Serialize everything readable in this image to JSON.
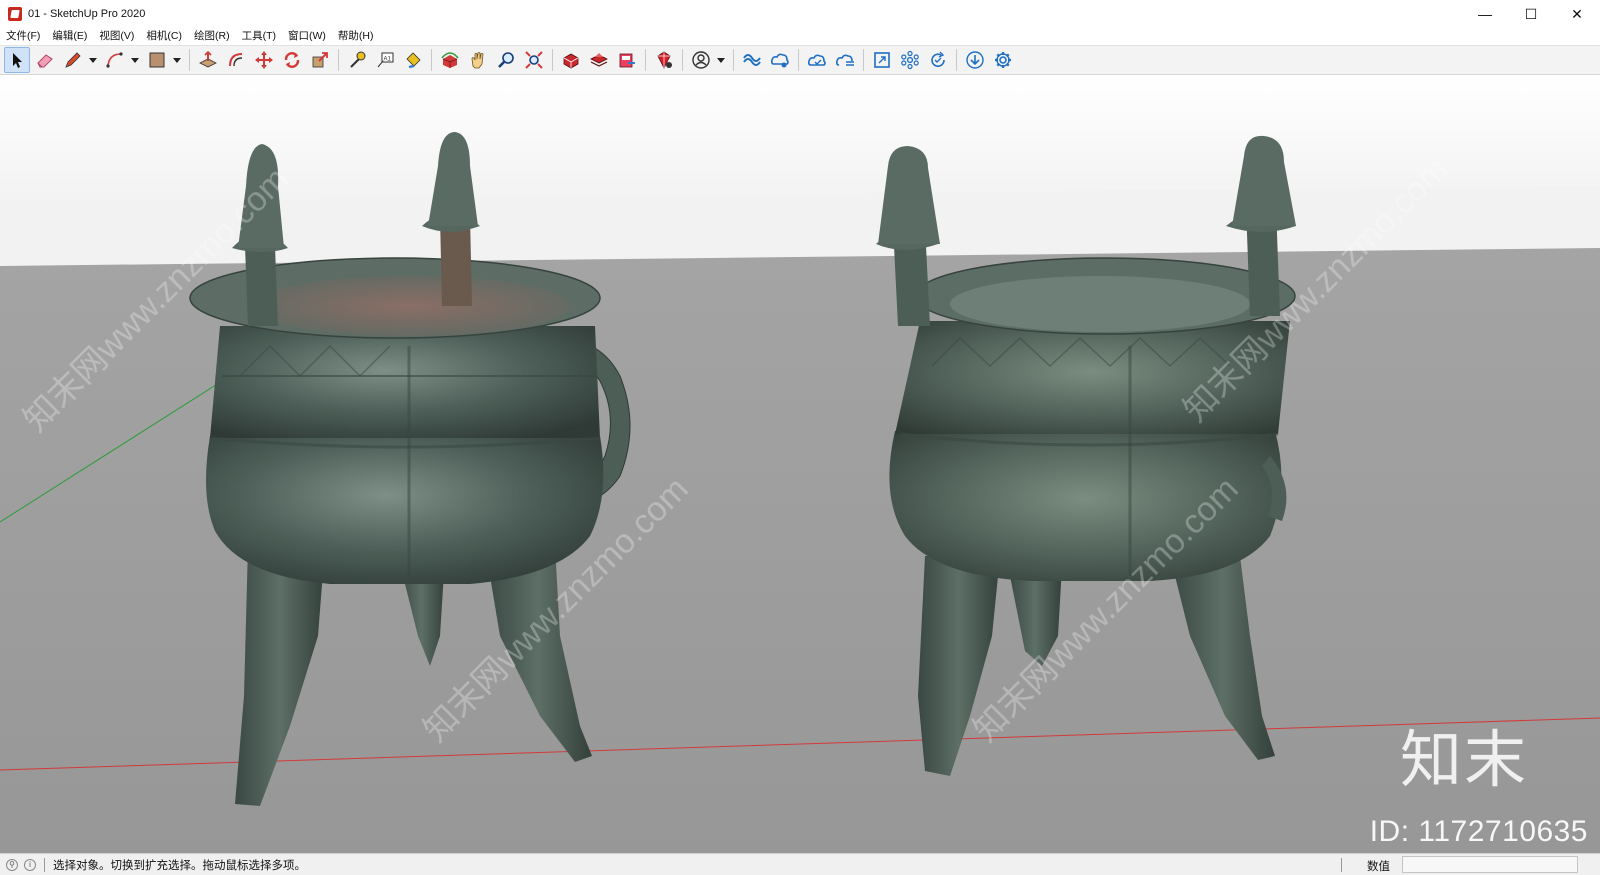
{
  "window": {
    "title": "01 - SketchUp Pro 2020",
    "minimize": "—",
    "maximize": "☐",
    "close": "✕"
  },
  "menu": [
    "文件(F)",
    "编辑(E)",
    "视图(V)",
    "相机(C)",
    "绘图(R)",
    "工具(T)",
    "窗口(W)",
    "帮助(H)"
  ],
  "toolbar": {
    "tools": [
      "select-tool-icon",
      "eraser-tool-icon",
      "pencil-line-tool-icon",
      "arc-tool-icon",
      "rectangle-tool-icon",
      "push-pull-tool-icon",
      "offset-tool-icon",
      "move-tool-icon",
      "rotate-tool-icon",
      "scale-tool-icon",
      "tape-measure-tool-icon",
      "text-tool-icon",
      "paint-bucket-tool-icon",
      "orbit-tool-icon",
      "pan-tool-icon",
      "zoom-tool-icon",
      "zoom-extents-tool-icon",
      "3d-warehouse-icon",
      "extension-warehouse-icon",
      "layout-send-icon",
      "extension-manager-icon",
      "account-icon",
      "trimble-connect-icon",
      "trimble-connect-share-icon",
      "cloud-sync-icon",
      "cloud-list-icon",
      "window-icon",
      "components-icon",
      "refresh-icon",
      "download-icon",
      "settings-gear-icon"
    ],
    "accent": "#1f6fc4"
  },
  "viewport": {
    "sky_color": "#ffffff",
    "ground_color": "#9a9a9a",
    "axis_red": "#d23a3a",
    "axis_green": "#2e9b3a",
    "watermark_logo": "知末",
    "watermark_id": "ID: 1172710635",
    "watermark_text": "知末网www.znzmo.com"
  },
  "status": {
    "hint": "选择对象。切换到扩充选择。拖动鼠标选择多项。",
    "measure_label": "数值",
    "measure_value": ""
  }
}
